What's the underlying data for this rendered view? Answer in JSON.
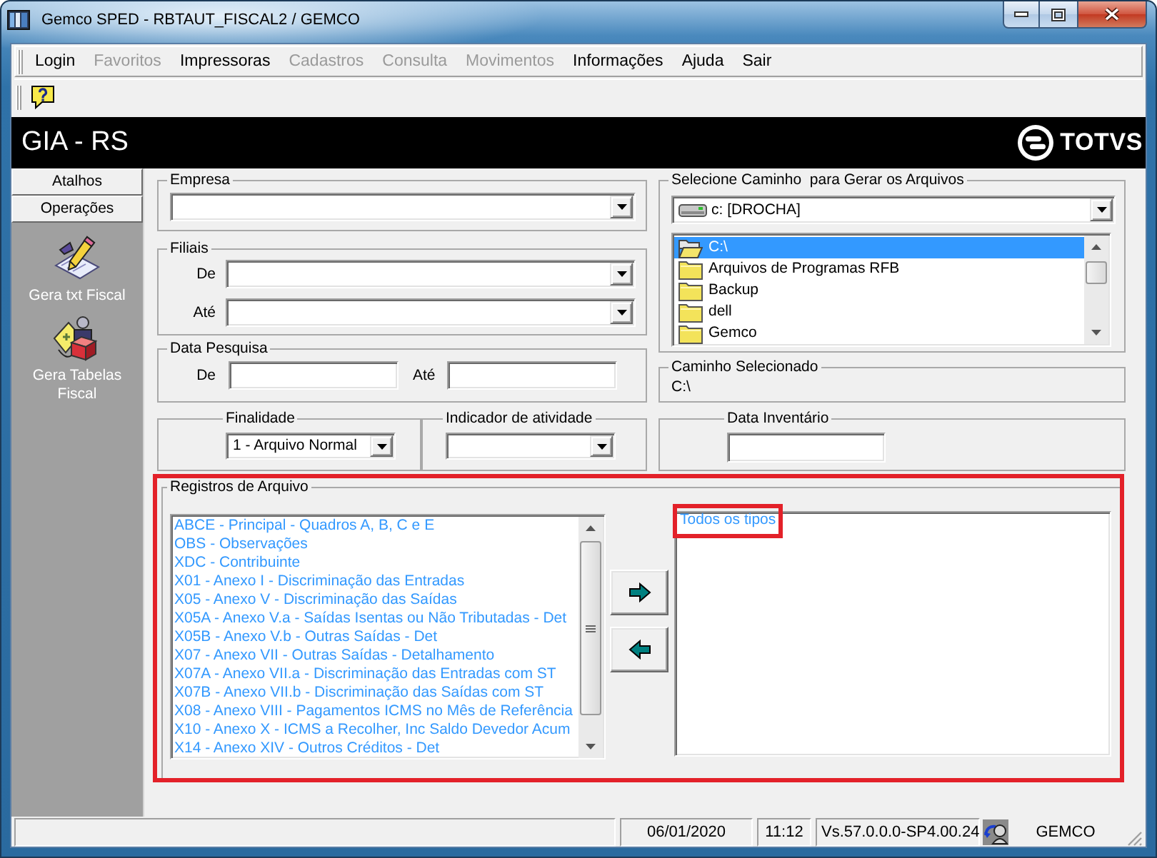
{
  "window": {
    "title": "Gemco SPED - RBTAUT_FISCAL2 / GEMCO"
  },
  "menu": [
    {
      "label": "Login",
      "disabled": false
    },
    {
      "label": "Favoritos",
      "disabled": true
    },
    {
      "label": "Impressoras",
      "disabled": false
    },
    {
      "label": "Cadastros",
      "disabled": true
    },
    {
      "label": "Consulta",
      "disabled": true
    },
    {
      "label": "Movimentos",
      "disabled": true
    },
    {
      "label": "Informações",
      "disabled": false
    },
    {
      "label": "Ajuda",
      "disabled": false
    },
    {
      "label": "Sair",
      "disabled": false
    }
  ],
  "header": {
    "title": "GIA - RS",
    "brand": "TOTVS"
  },
  "sidebar": {
    "sections": [
      "Atalhos",
      "Operações"
    ],
    "items": [
      {
        "label": "Gera txt Fiscal",
        "kind": "pencil"
      },
      {
        "label": "Gera Tabelas Fiscal",
        "kind": "cube"
      }
    ]
  },
  "empresa": {
    "label": "Empresa"
  },
  "filiais": {
    "label": "Filiais",
    "fields": [
      {
        "label": "De"
      },
      {
        "label": "Até"
      }
    ]
  },
  "data_pesquisa": {
    "label": "Data Pesquisa",
    "fields": [
      {
        "label": "De"
      },
      {
        "label": "Até"
      }
    ]
  },
  "finalidade": {
    "label": "Finalidade",
    "value": "1 - Arquivo Normal"
  },
  "indicador_atividade": {
    "label": "Indicador de atividade"
  },
  "caminho": {
    "label": "Selecione Caminho  para Gerar os Arquivos",
    "drive": "c: [DROCHA]",
    "folders": [
      {
        "name": "C:\\",
        "kind": "open",
        "selected": true
      },
      {
        "name": "Arquivos de Programas RFB",
        "kind": "closed",
        "selected": false
      },
      {
        "name": "Backup",
        "kind": "closed",
        "selected": false
      },
      {
        "name": "dell",
        "kind": "closed",
        "selected": false
      },
      {
        "name": "Gemco",
        "kind": "closed",
        "selected": false
      }
    ]
  },
  "caminho_selecionado": {
    "label": "Caminho Selecionado",
    "value": "C:\\"
  },
  "data_inventario": {
    "label": "Data Inventário"
  },
  "registros": {
    "label": "Registros de Arquivo",
    "highlighted": true,
    "available": [
      {
        "label": "ABCE - Principal - Quadros A, B, C e E",
        "selected": false
      },
      {
        "label": "OBS - Observações",
        "selected": false
      },
      {
        "label": "XDC - Contribuinte",
        "selected": false
      },
      {
        "label": "X01 - Anexo I - Discriminação das Entradas",
        "selected": false
      },
      {
        "label": "X05 - Anexo V - Discriminação das Saídas",
        "selected": false
      },
      {
        "label": "X05A - Anexo V.a - Saídas Isentas ou Não Tributadas - Det",
        "selected": false
      },
      {
        "label": "X05B - Anexo V.b - Outras Saídas - Det",
        "selected": false
      },
      {
        "label": "X07 - Anexo VII - Outras Saídas - Detalhamento",
        "selected": false
      },
      {
        "label": "X07A - Anexo VII.a - Discriminação das Entradas com ST",
        "selected": false
      },
      {
        "label": "X07B - Anexo VII.b - Discriminação das Saídas com ST",
        "selected": false
      },
      {
        "label": "X08 - Anexo VIII - Pagamentos ICMS no Mês de Referência",
        "selected": false
      },
      {
        "label": "X10 - Anexo X - ICMS a Recolher, Inc Saldo Devedor Acum",
        "selected": false
      },
      {
        "label": "X14 - Anexo XIV - Outros Créditos - Det",
        "selected": false
      }
    ],
    "chosen": [
      {
        "label": "Todos os tipos",
        "selected": false,
        "highlighted": true
      }
    ]
  },
  "status_bar": {
    "date": "06/01/2020",
    "time": "11:12",
    "version": "Vs.57.0.0.0-SP4.00.24",
    "user": "GEMCO"
  }
}
